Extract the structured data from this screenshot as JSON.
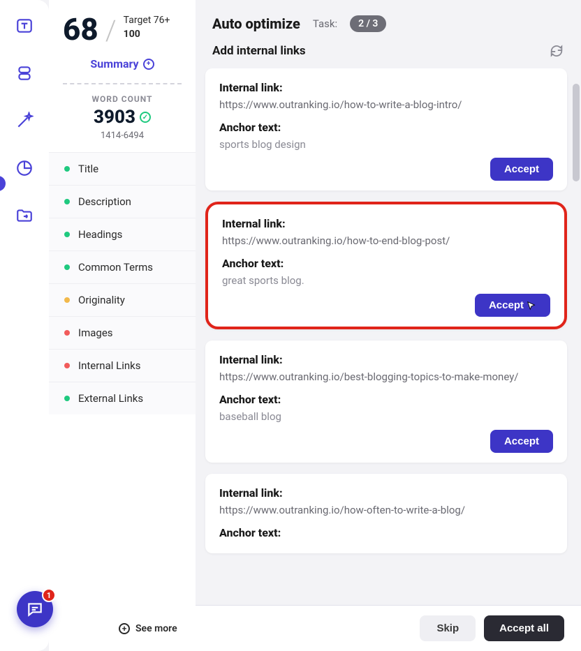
{
  "score": {
    "value": "68",
    "target_label": "Target 76+",
    "max": "100",
    "summary_label": "Summary"
  },
  "word_count": {
    "label": "WORD COUNT",
    "value": "3903",
    "range": "1414-6494"
  },
  "sections": [
    {
      "label": "Title",
      "status": "green"
    },
    {
      "label": "Description",
      "status": "green"
    },
    {
      "label": "Headings",
      "status": "green"
    },
    {
      "label": "Common Terms",
      "status": "green"
    },
    {
      "label": "Originality",
      "status": "yellow"
    },
    {
      "label": "Images",
      "status": "red"
    },
    {
      "label": "Internal Links",
      "status": "red"
    },
    {
      "label": "External Links",
      "status": "green"
    }
  ],
  "see_more": "See more",
  "header": {
    "title": "Auto optimize",
    "task_label": "Task:",
    "task_progress": "2 / 3",
    "subtitle": "Add internal links"
  },
  "link_label": "Internal link:",
  "anchor_label": "Anchor text:",
  "accept_label": "Accept",
  "cards": [
    {
      "url": "https://www.outranking.io/how-to-write-a-blog-intro/",
      "anchor": "sports blog design",
      "highlight": false,
      "cursor": false
    },
    {
      "url": "https://www.outranking.io/how-to-end-blog-post/",
      "anchor": "great sports blog.",
      "highlight": true,
      "cursor": true
    },
    {
      "url": "https://www.outranking.io/best-blogging-topics-to-make-money/",
      "anchor": "baseball blog",
      "highlight": false,
      "cursor": false
    },
    {
      "url": "https://www.outranking.io/how-often-to-write-a-blog/",
      "anchor": "",
      "highlight": false,
      "cursor": false
    }
  ],
  "footer": {
    "skip": "Skip",
    "accept_all": "Accept all"
  },
  "chat_badge": "1"
}
